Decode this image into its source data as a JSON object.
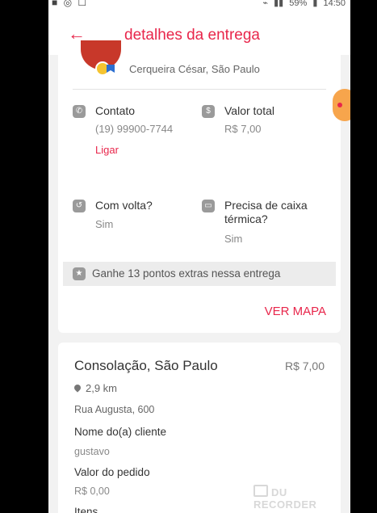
{
  "statusbar": {
    "battery_percent": "59%",
    "time": "14:50"
  },
  "header": {
    "title": "detalhes da entrega"
  },
  "origin": {
    "address": "Cerqueira César, São Paulo"
  },
  "details": {
    "contact_label": "Contato",
    "contact_value": "(19) 99900-7744",
    "call_label": "Ligar",
    "total_label": "Valor total",
    "total_value": "R$ 7,00",
    "return_label": "Com volta?",
    "return_value": "Sim",
    "thermal_label_line1": "Precisa de caixa",
    "thermal_label_line2": "térmica?",
    "thermal_value": "Sim"
  },
  "bonus": {
    "text": "Ganhe 13 pontos extras nessa entrega"
  },
  "map_button": "VER MAPA",
  "stop": {
    "neighborhood": "Consolação, São Paulo",
    "price": "R$ 7,00",
    "distance": "2,9 km",
    "street": "Rua Augusta, 600",
    "client_label": "Nome do(a) cliente",
    "client_value": "gustavo",
    "order_value_label": "Valor do pedido",
    "order_value": "R$ 0,00",
    "items_label": "Itens"
  },
  "watermark": "DU RECORDER",
  "colors": {
    "accent": "#e8264b",
    "background": "#f2f2f2",
    "orange_bubble": "#f7a54c"
  }
}
